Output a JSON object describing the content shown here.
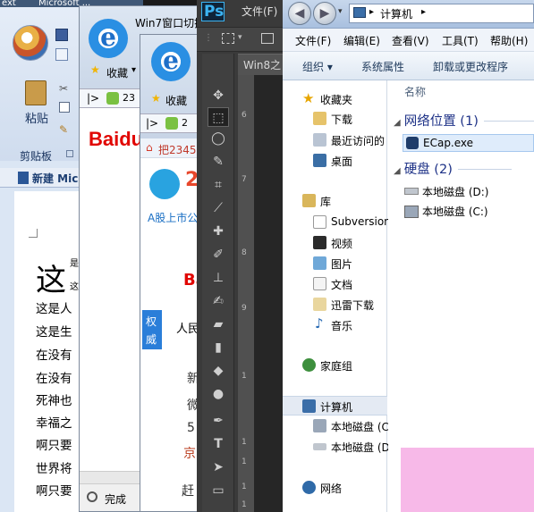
{
  "word": {
    "title": "Microsoft ...",
    "title_prefix": "ext",
    "paste_label": "粘贴",
    "clipboard_label": "剪贴板",
    "new_doc_tab": "新建 Mic",
    "big_char": "这",
    "small_chars": [
      "是",
      "这"
    ],
    "lines": [
      "这是人",
      "这是生",
      "在没有",
      "在没有",
      "死神也",
      "幸福之",
      "啊只要",
      "世界将",
      "啊只要"
    ]
  },
  "ie_back": {
    "window_title": "Win7窗口切换",
    "favorites": "收藏",
    "tab_num": "23",
    "brand": "Baidu",
    "status": "完成"
  },
  "ie_front": {
    "favorites": "收藏",
    "tab_num": "2",
    "home_link": "把2345",
    "logo_num": "2",
    "slogan": "A股上市公",
    "brand_partial": "Ba",
    "side_tab": "权威",
    "search_text": "人民",
    "news": [
      "新",
      "微",
      "5",
      "京",
      "赶"
    ]
  },
  "photoshop": {
    "logo": "Ps",
    "menu_file": "文件(F)",
    "doc_tab": "Win8之",
    "ruler_marks": [
      "6",
      "7",
      "8",
      "9",
      "1",
      "1",
      "1",
      "1",
      "1"
    ]
  },
  "explorer": {
    "address": "计算机",
    "menu": [
      "文件(F)",
      "编辑(E)",
      "查看(V)",
      "工具(T)",
      "帮助(H)"
    ],
    "commands": [
      "组织 ▾",
      "系统属性",
      "卸载或更改程序"
    ],
    "nav": {
      "favorites": "收藏夹",
      "downloads": "下载",
      "recent": "最近访问的",
      "desktop": "桌面",
      "library": "库",
      "subversion": "Subversion",
      "video": "视频",
      "pictures": "图片",
      "documents": "文档",
      "xunlei": "迅雷下载",
      "music": "音乐",
      "homegroup": "家庭组",
      "computer": "计算机",
      "disk_c": "本地磁盘 (C",
      "disk_d": "本地磁盘 (D",
      "network": "网络"
    },
    "column_name": "名称",
    "group_network": "网络位置 (1)",
    "net_item": "ECap.exe",
    "group_disk": "硬盘 (2)",
    "disks": [
      "本地磁盘 (D:)",
      "本地磁盘 (C:)"
    ]
  }
}
